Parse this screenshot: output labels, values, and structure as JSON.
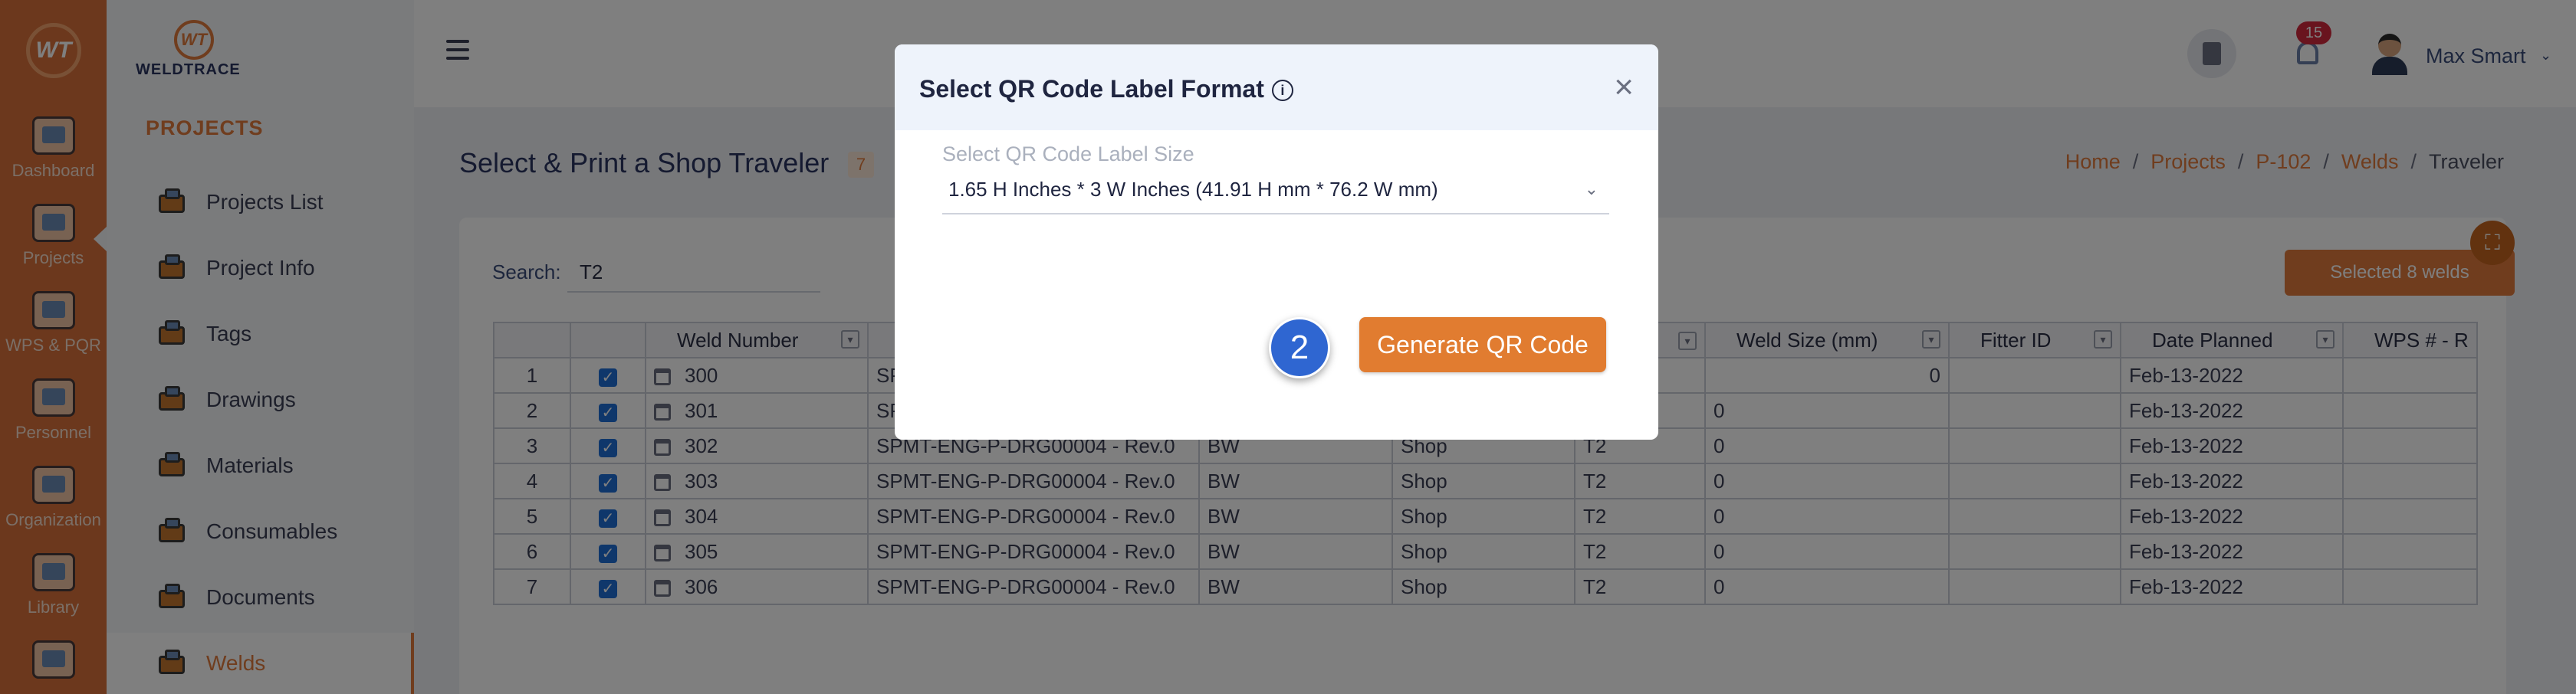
{
  "rail": {
    "items": [
      {
        "label": "Dashboard"
      },
      {
        "label": "Projects"
      },
      {
        "label": "WPS & PQR"
      },
      {
        "label": "Personnel"
      },
      {
        "label": "Organization"
      },
      {
        "label": "Library"
      }
    ]
  },
  "nav": {
    "logo_text": "WELDTRACE",
    "logo_mark": "WT",
    "heading": "PROJECTS",
    "items": [
      {
        "label": "Projects List"
      },
      {
        "label": "Project Info"
      },
      {
        "label": "Tags"
      },
      {
        "label": "Drawings"
      },
      {
        "label": "Materials"
      },
      {
        "label": "Consumables"
      },
      {
        "label": "Documents"
      },
      {
        "label": "Welds"
      }
    ]
  },
  "topbar": {
    "notification_count": "15",
    "user_name": "Max Smart"
  },
  "page": {
    "title": "Select & Print a Shop Traveler",
    "count": "7",
    "breadcrumb": [
      "Home",
      "Projects",
      "P-102",
      "Welds",
      "Traveler"
    ],
    "search_label": "Search:",
    "search_value": "T2",
    "selected_label": "Selected 8 welds"
  },
  "table": {
    "headers": [
      "",
      "",
      "Weld Number",
      "",
      "",
      "",
      "",
      "Weld Size (mm)",
      "Fitter ID",
      "Date Planned",
      "WPS # - R"
    ],
    "rows": [
      {
        "n": "1",
        "weld": "300",
        "drawing": "SP",
        "type": "",
        "loc": "",
        "cls": "",
        "size": "0",
        "fitter": "",
        "date": "Feb-13-2022"
      },
      {
        "n": "2",
        "weld": "301",
        "drawing": "SP",
        "type": "",
        "loc": "",
        "cls": "",
        "size": "0",
        "fitter": "",
        "date": "Feb-13-2022"
      },
      {
        "n": "3",
        "weld": "302",
        "drawing": "SPMT-ENG-P-DRG00004 - Rev.0",
        "type": "BW",
        "loc": "Shop",
        "cls": "T2",
        "size": "0",
        "fitter": "",
        "date": "Feb-13-2022"
      },
      {
        "n": "4",
        "weld": "303",
        "drawing": "SPMT-ENG-P-DRG00004 - Rev.0",
        "type": "BW",
        "loc": "Shop",
        "cls": "T2",
        "size": "0",
        "fitter": "",
        "date": "Feb-13-2022"
      },
      {
        "n": "5",
        "weld": "304",
        "drawing": "SPMT-ENG-P-DRG00004 - Rev.0",
        "type": "BW",
        "loc": "Shop",
        "cls": "T2",
        "size": "0",
        "fitter": "",
        "date": "Feb-13-2022"
      },
      {
        "n": "6",
        "weld": "305",
        "drawing": "SPMT-ENG-P-DRG00004 - Rev.0",
        "type": "BW",
        "loc": "Shop",
        "cls": "T2",
        "size": "0",
        "fitter": "",
        "date": "Feb-13-2022"
      },
      {
        "n": "7",
        "weld": "306",
        "drawing": "SPMT-ENG-P-DRG00004 - Rev.0",
        "type": "BW",
        "loc": "Shop",
        "cls": "T2",
        "size": "0",
        "fitter": "",
        "date": "Feb-13-2022"
      }
    ]
  },
  "modal": {
    "title": "Select QR Code Label Format",
    "close_glyph": "×",
    "field_label": "Select QR Code Label Size",
    "field_value": "1.65 H Inches * 3 W Inches (41.91 H mm * 76.2 W mm)",
    "step": "2",
    "generate_label": "Generate QR Code"
  }
}
